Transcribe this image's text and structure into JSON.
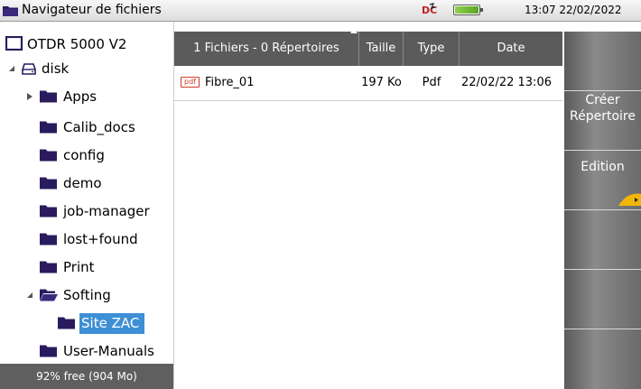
{
  "window": {
    "title": "Navigateur de fichiers",
    "clock": "13:07 22/02/2022",
    "status_badge": "DC",
    "battery_icon": "battery-icon"
  },
  "tree": {
    "items": [
      {
        "label": "OTDR 5000 V2",
        "icon": "device-icon"
      },
      {
        "label": "disk",
        "icon": "disk-icon",
        "expander": "expanded"
      },
      {
        "label": "Apps",
        "icon": "folder-icon",
        "expander": "collapsed"
      },
      {
        "label": "Calib_docs",
        "icon": "folder-icon"
      },
      {
        "label": "config",
        "icon": "folder-icon"
      },
      {
        "label": "demo",
        "icon": "folder-icon"
      },
      {
        "label": "job-manager",
        "icon": "folder-icon"
      },
      {
        "label": "lost+found",
        "icon": "folder-icon"
      },
      {
        "label": "Print",
        "icon": "folder-icon"
      },
      {
        "label": "Softing",
        "icon": "folder-open-icon",
        "expander": "expanded"
      },
      {
        "label": "Site ZAC",
        "icon": "folder-icon",
        "selected": true
      },
      {
        "label": "User-Manuals",
        "icon": "folder-icon"
      }
    ],
    "free_space": "92% free (904 Mo)"
  },
  "table": {
    "columns": [
      "1 Fichiers - 0 Répertoires",
      "Taille",
      "Type",
      "Date"
    ],
    "rows": [
      {
        "icon": "pdf",
        "name": "Fibre_01",
        "size": "197 Ko",
        "type": "Pdf",
        "date": "22/02/22 13:06"
      }
    ]
  },
  "side_menu": {
    "create_dir": [
      "Créer",
      "Répertoire"
    ],
    "edition": "Edition"
  },
  "colors": {
    "header": "#5b5b5b",
    "selection": "#3d8fd6",
    "folder": "#2a1b5e",
    "accent": "#f2b705"
  }
}
